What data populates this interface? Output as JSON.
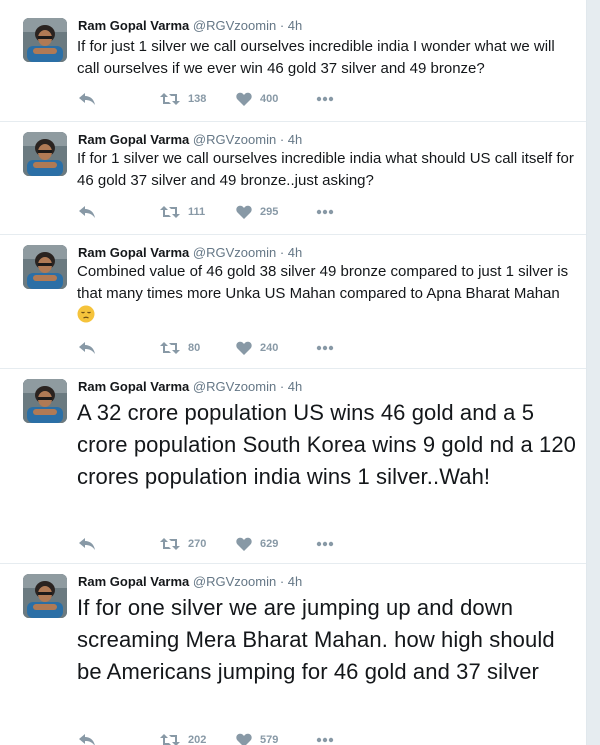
{
  "author": {
    "name": "Ram Gopal Varma",
    "handle": "@RGVzoomin",
    "time": "4h"
  },
  "separator": "·",
  "tweets": [
    {
      "text": "If for just 1 silver we call ourselves incredible india I wonder what we will call ourselves if we ever win 46 gold 37 silver and 49 bronze?",
      "retweets": "138",
      "likes": "400"
    },
    {
      "text": "If for 1 silver we call ourselves incredible india what should US call itself for 46 gold 37 silver and 49 bronze..just asking?",
      "retweets": "111",
      "likes": "295"
    },
    {
      "text": "Combined value of 46 gold 38 silver 49 bronze compared to just 1 silver is that many times more Unka US Mahan compared to Apna Bharat Mahan",
      "retweets": "80",
      "likes": "240",
      "emoji": "pensive-face-emoji"
    },
    {
      "text": "A 32 crore population US wins 46 gold and a 5 crore population South Korea wins 9 gold nd a 120 crores population india wins 1 silver..Wah!",
      "retweets": "270",
      "likes": "629"
    },
    {
      "text": "If for one silver we are jumping up and down screaming Mera Bharat Mahan. how high should be Americans jumping for 46 gold and 37 silver",
      "retweets": "202",
      "likes": "579"
    }
  ],
  "icons": {
    "reply": "reply-icon",
    "retweet": "retweet-icon",
    "like": "heart-icon",
    "more": "more-dots-icon"
  },
  "colors": {
    "action_gray": "#8899a6",
    "meta_gray": "#657786",
    "divider": "#e6ecf0",
    "emoji_yellow": "#f5c33b"
  }
}
